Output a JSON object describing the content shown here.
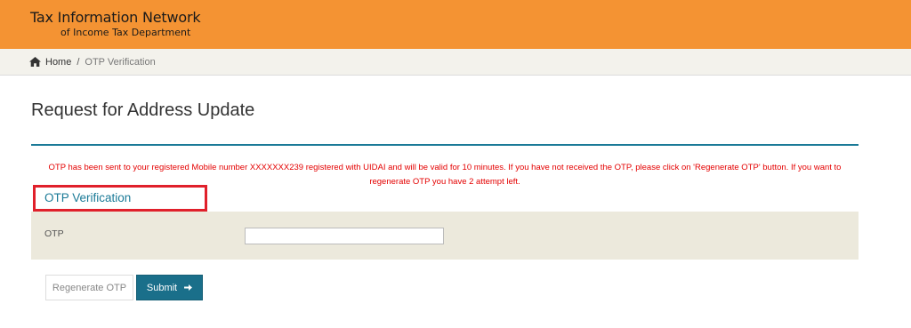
{
  "header": {
    "brand_line1": "Tax Information Network",
    "brand_line2": "of Income Tax Department",
    "bg_color": "#f49333"
  },
  "breadcrumb": {
    "home_label": "Home",
    "separator": "/",
    "current": "OTP Verification",
    "home_icon": "home-icon"
  },
  "page": {
    "title": "Request for Address Update",
    "accent_color": "#1a7a97"
  },
  "otp_message": {
    "text": "OTP has been sent to your registered Mobile number XXXXXXX239 registered with UIDAI and will be valid for 10 minutes. If you have not received the OTP, please click on 'Regenerate OTP' button. If you want to regenerate OTP you have 2 attempt left.",
    "color": "#e40000"
  },
  "section": {
    "title": "OTP Verification"
  },
  "form": {
    "otp_label": "OTP",
    "otp_value": "",
    "otp_placeholder": ""
  },
  "buttons": {
    "regenerate_label": "Regenerate OTP",
    "submit_label": "Submit",
    "submit_icon": "arrow-right-icon",
    "submit_color": "#1a6f8a"
  }
}
